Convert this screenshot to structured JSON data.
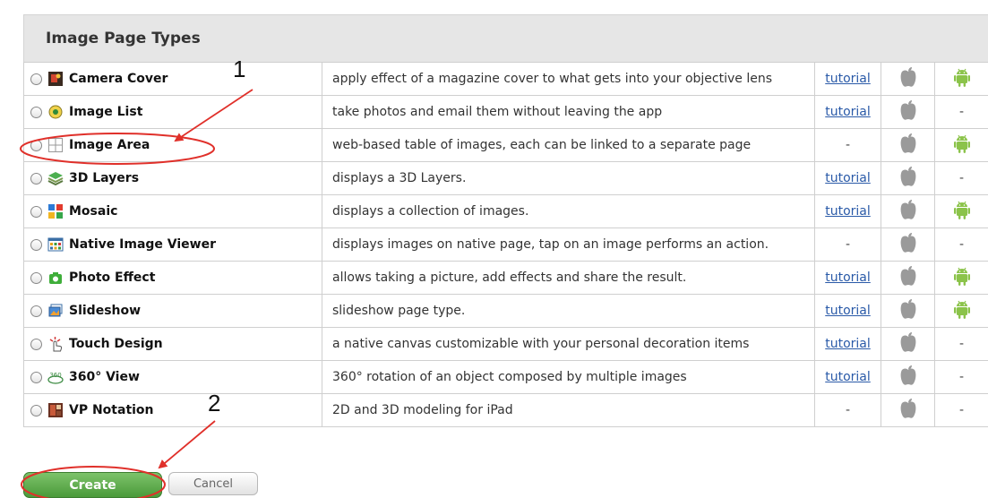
{
  "panel": {
    "title": "Image Page Types"
  },
  "rows": [
    {
      "name": "Camera Cover",
      "icon": "camera-cover-icon",
      "description": "apply effect of a magazine cover to what gets into your objective lens",
      "tutorial": "tutorial",
      "ios": true,
      "android": true
    },
    {
      "name": "Image List",
      "icon": "image-list-icon",
      "description": "take photos and email them without leaving the app",
      "tutorial": "tutorial",
      "ios": true,
      "android": false
    },
    {
      "name": "Image Area",
      "icon": "image-area-icon",
      "description": "web-based table of images, each can be linked to a separate page",
      "tutorial": "-",
      "ios": true,
      "android": true
    },
    {
      "name": "3D Layers",
      "icon": "3d-layers-icon",
      "description": "displays a 3D Layers.",
      "tutorial": "tutorial",
      "ios": true,
      "android": false
    },
    {
      "name": "Mosaic",
      "icon": "mosaic-icon",
      "description": "displays a collection of images.",
      "tutorial": "tutorial",
      "ios": true,
      "android": true
    },
    {
      "name": "Native Image Viewer",
      "icon": "native-image-viewer-icon",
      "description": "displays images on native page, tap on an image performs an action.",
      "tutorial": "-",
      "ios": true,
      "android": false
    },
    {
      "name": "Photo Effect",
      "icon": "photo-effect-icon",
      "description": "allows taking a picture, add effects and share the result.",
      "tutorial": "tutorial",
      "ios": true,
      "android": true
    },
    {
      "name": "Slideshow",
      "icon": "slideshow-icon",
      "description": "slideshow page type.",
      "tutorial": "tutorial",
      "ios": true,
      "android": true
    },
    {
      "name": "Touch Design",
      "icon": "touch-design-icon",
      "description": "a native canvas customizable with your personal decoration items",
      "tutorial": "tutorial",
      "ios": true,
      "android": false
    },
    {
      "name": "360° View",
      "icon": "360-view-icon",
      "description": "360° rotation of an object composed by multiple images",
      "tutorial": "tutorial",
      "ios": true,
      "android": false
    },
    {
      "name": "VP Notation",
      "icon": "vp-notation-icon",
      "description": "2D and 3D modeling for iPad",
      "tutorial": "-",
      "ios": true,
      "android": false
    }
  ],
  "unavailable_mark": "-",
  "buttons": {
    "create": "Create",
    "cancel": "Cancel"
  },
  "annotations": {
    "marker_1": "1",
    "marker_2": "2",
    "highlight_color": "#e0302a"
  },
  "colors": {
    "header_bg": "#e6e6e6",
    "link": "#2a5aa8",
    "create_green": "#4a9a3a",
    "android_green": "#8bc34a",
    "apple_gray": "#9a9a9a"
  }
}
